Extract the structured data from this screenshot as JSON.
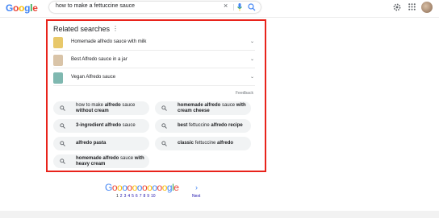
{
  "header": {
    "logo_letters": [
      {
        "char": "G",
        "color": "#4285f4"
      },
      {
        "char": "o",
        "color": "#ea4335"
      },
      {
        "char": "o",
        "color": "#fbbc05"
      },
      {
        "char": "g",
        "color": "#4285f4"
      },
      {
        "char": "l",
        "color": "#34a853"
      },
      {
        "char": "e",
        "color": "#ea4335"
      }
    ],
    "search_query": "how to make a fettuccine sauce",
    "icons": [
      "close-icon",
      "mic-icon",
      "search-icon",
      "settings-icon",
      "apps-icon",
      "avatar"
    ]
  },
  "related": {
    "title": "Related searches",
    "expandable": [
      {
        "label": "Homemade alfredo sauce with milk",
        "thumb_color": "#e8c86a"
      },
      {
        "label": "Best Alfredo sauce in a jar",
        "thumb_color": "#d9c4a8"
      },
      {
        "label": "Vegan Alfredo sauce",
        "thumb_color": "#7fb8b0"
      }
    ],
    "feedback": "Feedback",
    "chips": [
      {
        "parts": [
          {
            "t": "how to make ",
            "b": false
          },
          {
            "t": "alfredo",
            "b": true
          },
          {
            "t": " sauce ",
            "b": false
          },
          {
            "t": "without cream",
            "b": true
          }
        ]
      },
      {
        "parts": [
          {
            "t": "homemade alfredo",
            "b": true
          },
          {
            "t": " sauce ",
            "b": false
          },
          {
            "t": "with cream cheese",
            "b": true
          }
        ]
      },
      {
        "parts": [
          {
            "t": "3-ingredient alfredo",
            "b": true
          },
          {
            "t": " sauce",
            "b": false
          }
        ]
      },
      {
        "parts": [
          {
            "t": "best",
            "b": true
          },
          {
            "t": " fettuccine ",
            "b": false
          },
          {
            "t": "alfredo recipe",
            "b": true
          }
        ]
      },
      {
        "parts": [
          {
            "t": "alfredo pasta",
            "b": true
          }
        ]
      },
      {
        "parts": [
          {
            "t": "classic",
            "b": true
          },
          {
            "t": " fettuccine ",
            "b": false
          },
          {
            "t": "alfredo",
            "b": true
          }
        ]
      },
      {
        "parts": [
          {
            "t": "homemade alfredo",
            "b": true
          },
          {
            "t": " sauce ",
            "b": false
          },
          {
            "t": "with heavy cream",
            "b": true
          }
        ]
      }
    ]
  },
  "pagination": {
    "logo": "Gooooooooooogle",
    "pages": [
      "1",
      "2",
      "3",
      "4",
      "5",
      "6",
      "7",
      "8",
      "9",
      "10"
    ],
    "current": "1",
    "next_label": "Next",
    "next_icon": "chevron-right-icon"
  },
  "colors": {
    "highlight_border": "#e8231b",
    "chip_bg": "#f1f3f4",
    "link": "#1a0dab"
  }
}
